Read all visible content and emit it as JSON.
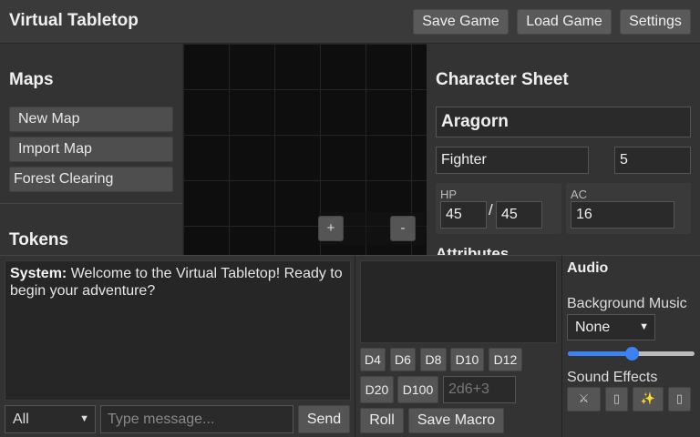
{
  "header": {
    "title": "Virtual Tabletop",
    "buttons": {
      "save": "Save Game",
      "load": "Load Game",
      "settings": "Settings"
    }
  },
  "maps": {
    "title": "Maps",
    "items": [
      "New Map",
      "Import Map",
      "Forest Clearing"
    ]
  },
  "tokens": {
    "title": "Tokens"
  },
  "map_controls": {
    "zoom_in": "+",
    "zoom_out": "-"
  },
  "character": {
    "title": "Character Sheet",
    "name": "Aragorn",
    "class": "Fighter",
    "level": "5",
    "hp_label": "HP",
    "hp_current": "45",
    "hp_separator": "/",
    "hp_max": "45",
    "ac_label": "AC",
    "ac": "16",
    "attributes_title": "Attributes"
  },
  "chat": {
    "messages": [
      {
        "sender": "System:",
        "text": " Welcome to the Virtual Tabletop! Ready to begin your adventure?"
      }
    ],
    "channel": "All",
    "placeholder": "Type message...",
    "send": "Send"
  },
  "dice": {
    "row1": [
      "D4",
      "D6",
      "D8",
      "D10",
      "D12"
    ],
    "row2": [
      "D20",
      "D100"
    ],
    "formula_placeholder": "2d6+3",
    "roll": "Roll",
    "save_macro": "Save Macro"
  },
  "audio": {
    "title": "Audio",
    "bg_music_label": "Background Music",
    "bg_music_selected": "None",
    "volume": 0.5,
    "sfx_label": "Sound Effects",
    "sfx_icons": [
      "sword-icon",
      "shield-icon",
      "magic-icon",
      "door-icon"
    ],
    "sfx_glyphs": [
      "⚔",
      "▯",
      "✨",
      "▯"
    ]
  }
}
